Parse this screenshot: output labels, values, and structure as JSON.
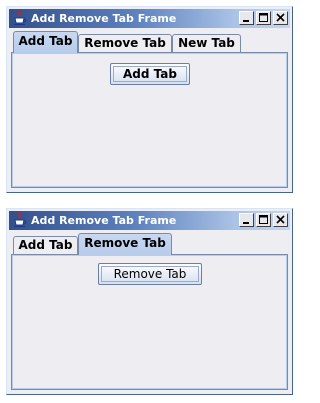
{
  "windows": [
    {
      "title": "Add Remove Tab Frame",
      "tabs": [
        "Add Tab",
        "Remove Tab",
        "New Tab"
      ],
      "selected_tab": "Add Tab",
      "action_button": "Add Tab"
    },
    {
      "title": "Add Remove Tab Frame",
      "tabs": [
        "Add Tab",
        "Remove Tab"
      ],
      "selected_tab": "Remove Tab",
      "action_button": "Remove Tab"
    }
  ],
  "colors": {
    "titlebar_start": "#33508c",
    "titlebar_end": "#c6d6f0",
    "selected_tab": "#b8ccec",
    "panel_background": "#eeeef2"
  },
  "icons": {
    "app": "java-cup-icon",
    "minimize": "minimize-icon",
    "maximize": "maximize-icon",
    "close": "close-icon"
  }
}
